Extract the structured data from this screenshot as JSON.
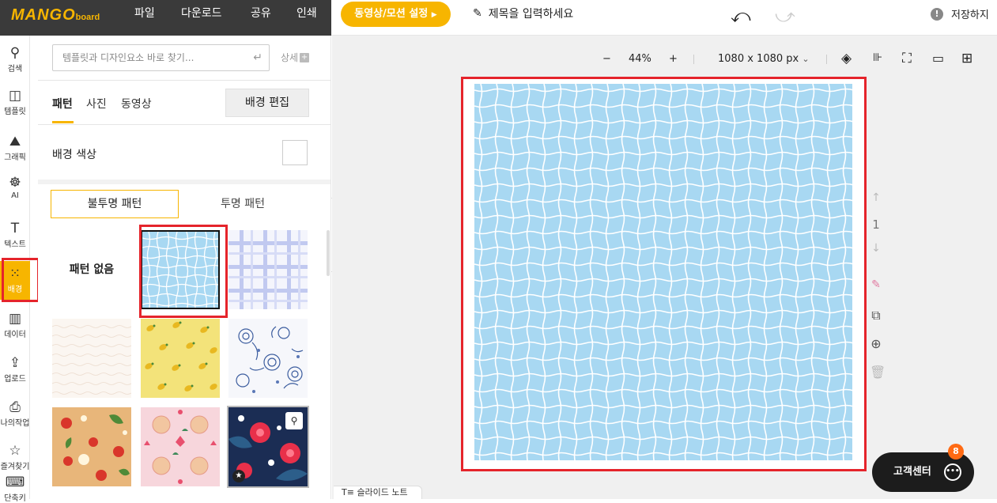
{
  "header": {
    "logo_main": "MANGO",
    "logo_sub": "board",
    "menu": [
      "파일",
      "다운로드",
      "공유",
      "인쇄"
    ],
    "video_button": "동영상/모션 설정",
    "title_placeholder": "제목을 입력하세요",
    "save_status": "저장하지"
  },
  "nav": {
    "items": [
      {
        "label": "검색",
        "icon": "search-icon"
      },
      {
        "label": "템플릿",
        "icon": "template-icon"
      },
      {
        "label": "그래픽",
        "icon": "graphic-icon"
      },
      {
        "label": "AI",
        "icon": "ai-icon"
      },
      {
        "label": "텍스트",
        "icon": "text-icon"
      },
      {
        "label": "배경",
        "icon": "background-icon"
      },
      {
        "label": "데이터",
        "icon": "chart-icon"
      },
      {
        "label": "업로드",
        "icon": "upload-icon"
      },
      {
        "label": "나의작업",
        "icon": "print-icon"
      },
      {
        "label": "즐겨찾기",
        "icon": "star-icon"
      },
      {
        "label": "단축키",
        "icon": "keyboard-icon"
      }
    ]
  },
  "panel": {
    "search_placeholder": "템플릿과 디자인요소 바로 찾기...",
    "detail_label": "상세",
    "tabs": [
      "패턴",
      "사진",
      "동영상"
    ],
    "edit_background": "배경 편집",
    "bg_color_label": "배경 색상",
    "segment_opaque": "불투명 패턴",
    "segment_transparent": "투명 패턴",
    "no_pattern": "패턴 없음"
  },
  "toolbar": {
    "zoom_minus": "−",
    "zoom_value": "44%",
    "zoom_plus": "+",
    "size_label": "1080 x 1080 px"
  },
  "canvas": {
    "page_number": "1",
    "pattern_color": "#a8d8f2"
  },
  "help": {
    "chat_label": "고객센터",
    "badge_count": "8"
  },
  "slide_note": "슬라이드 노트",
  "colors": {
    "accent": "#f7b500",
    "highlight": "#e5242b"
  }
}
